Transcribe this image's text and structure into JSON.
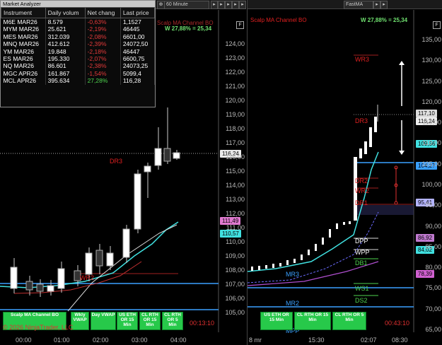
{
  "market_analyzer": {
    "title": "Market Analyzer",
    "columns": [
      "Instrument",
      "Daily volum",
      "Net chang",
      "Last price"
    ],
    "rows": [
      {
        "instrument": "M6E MAR26",
        "volume": "8.579",
        "net_change": "-0,63%",
        "last": "1,1527"
      },
      {
        "instrument": "MYM MAR26",
        "volume": "25.621",
        "net_change": "-2,19%",
        "last": "46445"
      },
      {
        "instrument": "MES MAR26",
        "volume": "312.039",
        "net_change": "-2,08%",
        "last": "6601,00"
      },
      {
        "instrument": "MNQ MAR26",
        "volume": "412.612",
        "net_change": "-2,39%",
        "last": "24072,50"
      },
      {
        "instrument": "YM MAR26",
        "volume": "19.848",
        "net_change": "-2,18%",
        "last": "46447"
      },
      {
        "instrument": "ES MAR26",
        "volume": "195.330",
        "net_change": "-2,07%",
        "last": "6600,75"
      },
      {
        "instrument": "NQ MAR26",
        "volume": "86.601",
        "net_change": "-2,38%",
        "last": "24073,25"
      },
      {
        "instrument": "MGC APR26",
        "volume": "161.867",
        "net_change": "-1,54%",
        "last": "5099,4"
      },
      {
        "instrument": "MCL APR26",
        "volume": "395.634",
        "net_change": "27,28%",
        "last": "116,28"
      }
    ]
  },
  "left_chart": {
    "timeframe": "60 Minute",
    "strategy_title": "Scalp MA Channel BO",
    "w_stat": "W 27,88% = 25,34",
    "f_box": "F",
    "y_ticks": [
      "124,00",
      "123,00",
      "122,00",
      "121,00",
      "120,00",
      "119,00",
      "118,00",
      "117,00",
      "116,00",
      "115,00",
      "114,00",
      "113,00",
      "112,00",
      "111,00",
      "110,00",
      "109,00",
      "108,00",
      "107,00",
      "106,00",
      "105,00"
    ],
    "x_ticks": [
      "00:00",
      "01:00",
      "02:00",
      "03:00",
      "04:00"
    ],
    "price_tags": {
      "last": "116,24",
      "mid": "111,49",
      "ma": "110,57"
    },
    "labels": {
      "dr3": "DR3",
      "wr2": "WR2"
    },
    "buttons": [
      "Scalp MA Channel BO",
      "Wkly VWAP",
      "Day VWAP",
      "US ETH OR 15 Min",
      "CL RTH OR 15 Min",
      "CL RTH OR 5 Min"
    ],
    "copyright": "© 2026 NinjaTrader, LLC",
    "countdown": "00:13:10"
  },
  "right_chart": {
    "instrument": "FastMA",
    "strategy_title": "Scalp MA Channel BO",
    "w_stat": "W 27,88% = 25,34",
    "f_box": "F",
    "y_ticks": [
      "135,00",
      "130,00",
      "125,00",
      "120,00",
      "115,00",
      "110,00",
      "105,00",
      "100,00",
      "95,00",
      "90,00",
      "85,00",
      "80,00",
      "75,00",
      "70,00",
      "65,00"
    ],
    "x_ticks": [
      "8 mr",
      "15:30",
      "02:07",
      "08:30"
    ],
    "price_tags": {
      "top": "117,10",
      "top2": "116,24",
      "a": "109,56",
      "b": "104,27",
      "c": "95,41",
      "d": "86,92",
      "e": "84,02",
      "f": "78,39"
    },
    "labels": {
      "wr3": "WR3",
      "dr3": "DR3",
      "dr2": "DR2",
      "wr2": "WR2",
      "dr1": "DR1",
      "dpp": "DPP",
      "wpp": "WPP",
      "db1": "DB1",
      "mr3": "MR3",
      "ws1": "WS1",
      "ds2": "DS2",
      "mr2": "MR2",
      "mpp": "MPP"
    },
    "buttons": [
      "US ETH OR 15 Min",
      "CL RTH OR 15 Min",
      "CL RTH OR 5 Min"
    ],
    "countdown": "00:43:10"
  }
}
